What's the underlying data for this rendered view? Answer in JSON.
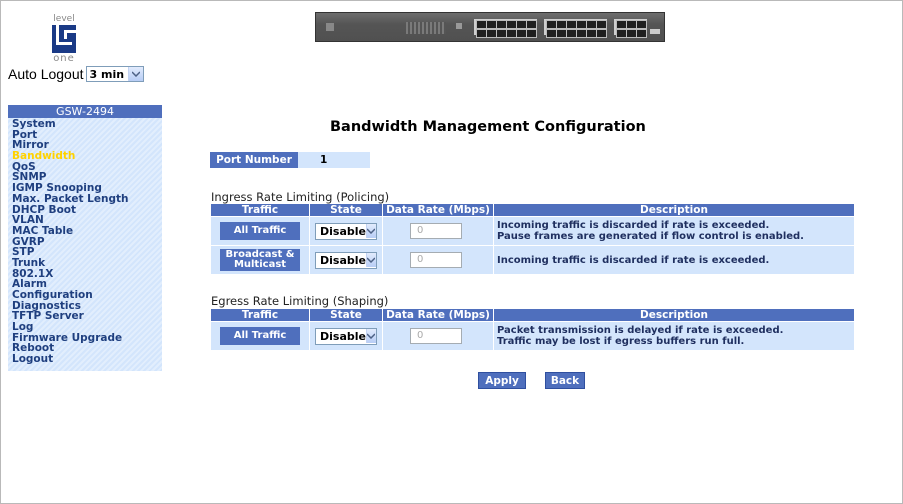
{
  "logo": {
    "top": "level",
    "bottom": "one"
  },
  "auto_logout": {
    "label": "Auto Logout",
    "value": "3 min"
  },
  "sidebar": {
    "title": "GSW-2494",
    "items": [
      {
        "label": "System"
      },
      {
        "label": "Port"
      },
      {
        "label": "Mirror"
      },
      {
        "label": "Bandwidth"
      },
      {
        "label": "QoS"
      },
      {
        "label": "SNMP"
      },
      {
        "label": "IGMP Snooping"
      },
      {
        "label": "Max. Packet Length"
      },
      {
        "label": "DHCP Boot"
      },
      {
        "label": "VLAN"
      },
      {
        "label": "MAC Table"
      },
      {
        "label": "GVRP"
      },
      {
        "label": "STP"
      },
      {
        "label": "Trunk"
      },
      {
        "label": "802.1X"
      },
      {
        "label": "Alarm"
      },
      {
        "label": "Configuration"
      },
      {
        "label": "Diagnostics"
      },
      {
        "label": "TFTP Server"
      },
      {
        "label": "Log"
      },
      {
        "label": "Firmware Upgrade"
      },
      {
        "label": "Reboot"
      },
      {
        "label": "Logout"
      }
    ],
    "active_index": 3
  },
  "main": {
    "title": "Bandwidth Management Configuration",
    "port_number_label": "Port Number",
    "port_number_value": "1",
    "ingress": {
      "title": "Ingress Rate Limiting (Policing)",
      "headers": [
        "Traffic",
        "State",
        "Data Rate (Mbps)",
        "Description"
      ],
      "rows": [
        {
          "traffic": "All Traffic",
          "state": "Disable",
          "rate": "0",
          "desc1": "Incoming traffic is discarded if rate is exceeded.",
          "desc2": "Pause frames are generated if flow control is enabled."
        },
        {
          "traffic1": "Broadcast &",
          "traffic2": "Multicast",
          "state": "Disable",
          "rate": "0",
          "desc1": "Incoming traffic is discarded if rate is exceeded."
        }
      ]
    },
    "egress": {
      "title": "Egress Rate Limiting (Shaping)",
      "headers": [
        "Traffic",
        "State",
        "Data Rate (Mbps)",
        "Description"
      ],
      "rows": [
        {
          "traffic": "All Traffic",
          "state": "Disable",
          "rate": "0",
          "desc1": "Packet transmission is delayed if rate is exceeded.",
          "desc2": "Traffic may be lost if egress buffers run full."
        }
      ]
    },
    "apply_label": "Apply",
    "back_label": "Back"
  },
  "colors": {
    "header_blue": "#4f6fbd",
    "cell_light": "#d3e5fc",
    "active_menu": "#ffd200"
  }
}
